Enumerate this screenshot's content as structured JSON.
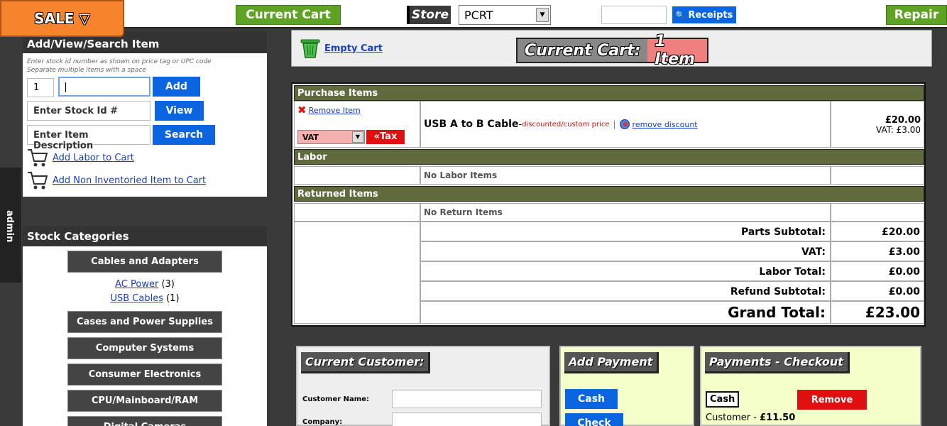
{
  "topbar": {
    "sale_label": "SALE ▽",
    "current_cart_label": "Current Cart",
    "store_label": "Store",
    "store_value": "PCRT",
    "receipts_label": "Receipts",
    "repair_label": "Repair"
  },
  "admin_tab": {
    "label": "admin"
  },
  "add_panel": {
    "title": "Add/View/Search Item",
    "hint_line1": "Enter stock id number as shown on price tag or UPC code",
    "hint_line2": "Separate multiple items with a space",
    "qty_value": "1",
    "add_label": "Add",
    "stock_id_placeholder": "Enter Stock Id #",
    "view_label": "View",
    "description_placeholder": "Enter Item Description",
    "search_label": "Search",
    "add_labor_link": "Add Labor to Cart",
    "add_non_inventoried_link": "Add Non Inventoried Item to Cart"
  },
  "categories": {
    "title": "Stock Categories",
    "items": [
      {
        "label": "Cables and Adapters"
      },
      {
        "label": "Cases and Power Supplies"
      },
      {
        "label": "Computer Systems"
      },
      {
        "label": "Consumer Electronics"
      },
      {
        "label": "CPU/Mainboard/RAM"
      },
      {
        "label": "Digital Cameras"
      }
    ],
    "subcategories": [
      {
        "label": "AC Power",
        "count": "(3)"
      },
      {
        "label": "USB Cables",
        "count": "(1)"
      }
    ]
  },
  "cart_header": {
    "empty_cart_label": "Empty Cart",
    "badge_label": "Current Cart:",
    "badge_count": "1 Item"
  },
  "cart": {
    "purchase_header": "Purchase Items",
    "remove_item_label": "Remove Item",
    "tax_select_value": "VAT",
    "tax_button_label": "«Tax",
    "item_name": "USB A to B Cable",
    "item_dash": " - ",
    "item_note": "discounted/custom price",
    "remove_discount_label": "remove discount",
    "item_price": "£20.00",
    "item_vat": "VAT: £3.00",
    "labor_header": "Labor",
    "no_labor": "No Labor Items",
    "returned_header": "Returned Items",
    "no_returns": "No Return Items",
    "totals": [
      {
        "label": "Parts Subtotal:",
        "value": "£20.00"
      },
      {
        "label": "VAT:",
        "value": "£3.00"
      },
      {
        "label": "Labor Total:",
        "value": "£0.00"
      },
      {
        "label": "Refund Subtotal:",
        "value": "£0.00"
      }
    ],
    "grand_total_label": "Grand Total:",
    "grand_total_value": "£23.00"
  },
  "customer": {
    "title": "Current Customer:",
    "name_label": "Customer Name:",
    "company_label": "Company:"
  },
  "add_payment": {
    "title": "Add Payment",
    "cash_label": "Cash",
    "check_label": "Check"
  },
  "checkout": {
    "title": "Payments - Checkout",
    "payment_type": "Cash",
    "remove_label": "Remove",
    "customer_line": "Customer - ",
    "customer_amount": "£11.50"
  },
  "colors": {
    "sale_orange": "#f5842c",
    "nav_green": "#5ea324",
    "action_blue": "#0b64e0",
    "section_olive": "#5f6b3c",
    "remove_red": "#e01010",
    "payment_panel": "#f2ffc8"
  }
}
